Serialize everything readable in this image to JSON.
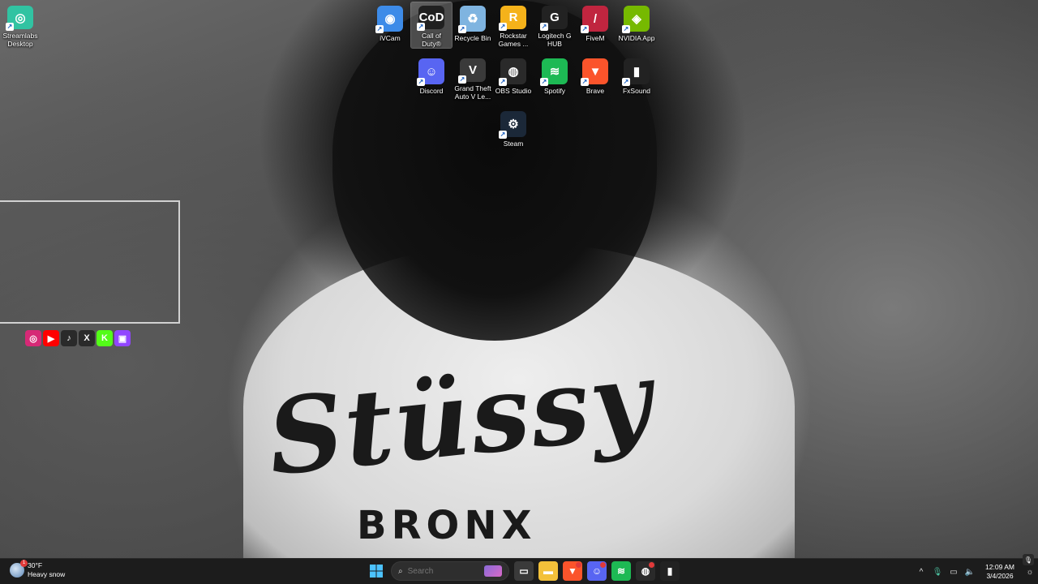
{
  "wallpaper": {
    "shirt_brand": "Stüssy",
    "shirt_sub": "BRONX"
  },
  "desktop_icons": [
    {
      "label": "Streamlabs\nDesktop",
      "glyph": "◎",
      "color": "#31c3a2"
    },
    {
      "label": "iVCam",
      "glyph": "◉",
      "color": "#3d8be8"
    },
    {
      "label": "Call of\nDuty®",
      "glyph": "CoD",
      "color": "#202020"
    },
    {
      "label": "Recycle Bin",
      "glyph": "♻",
      "color": "#7fb4e0"
    },
    {
      "label": "Rockstar\nGames ...",
      "glyph": "R",
      "color": "#f5b21a"
    },
    {
      "label": "Logitech G\nHUB",
      "glyph": "G",
      "color": "#222222"
    },
    {
      "label": "FiveM",
      "glyph": "/",
      "color": "#c0253f"
    },
    {
      "label": "NVIDIA App",
      "glyph": "◈",
      "color": "#76b900"
    },
    {
      "label": "Discord",
      "glyph": "☺",
      "color": "#5865f2"
    },
    {
      "label": "Grand Theft\nAuto V Le...",
      "glyph": "V",
      "color": "#3a3a3a"
    },
    {
      "label": "OBS Studio",
      "glyph": "◍",
      "color": "#2a2a2a"
    },
    {
      "label": "Spotify",
      "glyph": "≋",
      "color": "#1db954"
    },
    {
      "label": "Brave",
      "glyph": "▼",
      "color": "#fb542b"
    },
    {
      "label": "FxSound",
      "glyph": "▮",
      "color": "#222222"
    },
    {
      "label": "Steam",
      "glyph": "⚙",
      "color": "#1b2838"
    }
  ],
  "socials": [
    {
      "glyph": "◎",
      "color": "#d62976"
    },
    {
      "glyph": "▶",
      "color": "#ff0000"
    },
    {
      "glyph": "♪",
      "color": "#2a2a2a"
    },
    {
      "glyph": "X",
      "color": "#2a2a2a"
    },
    {
      "glyph": "K",
      "color": "#53fc18"
    },
    {
      "glyph": "▣",
      "color": "#9146ff"
    }
  ],
  "taskbar": {
    "weather": {
      "temp": "30°F",
      "condition": "Heavy snow",
      "badge": "1"
    },
    "search_placeholder": "Search",
    "apps": [
      {
        "name": "task-view",
        "glyph": "▭",
        "color": "#3a3a3a"
      },
      {
        "name": "file-explorer",
        "glyph": "▬",
        "color": "#f3c13a"
      },
      {
        "name": "brave",
        "glyph": "▼",
        "color": "#fb542b",
        "badge": true
      },
      {
        "name": "discord",
        "glyph": "☺",
        "color": "#5865f2",
        "badge": true
      },
      {
        "name": "spotify",
        "glyph": "≋",
        "color": "#1db954"
      },
      {
        "name": "obs-studio",
        "glyph": "◍",
        "color": "#2a2a2a",
        "badge": true
      },
      {
        "name": "fxsound",
        "glyph": "▮",
        "color": "#222222"
      }
    ],
    "clock": {
      "time": "12:09 AM",
      "date": "3/4/2026"
    },
    "tray": {
      "chevron": "^",
      "mic": "🎙",
      "network": "▭",
      "volume": "🔈",
      "notifications": "☼"
    }
  }
}
